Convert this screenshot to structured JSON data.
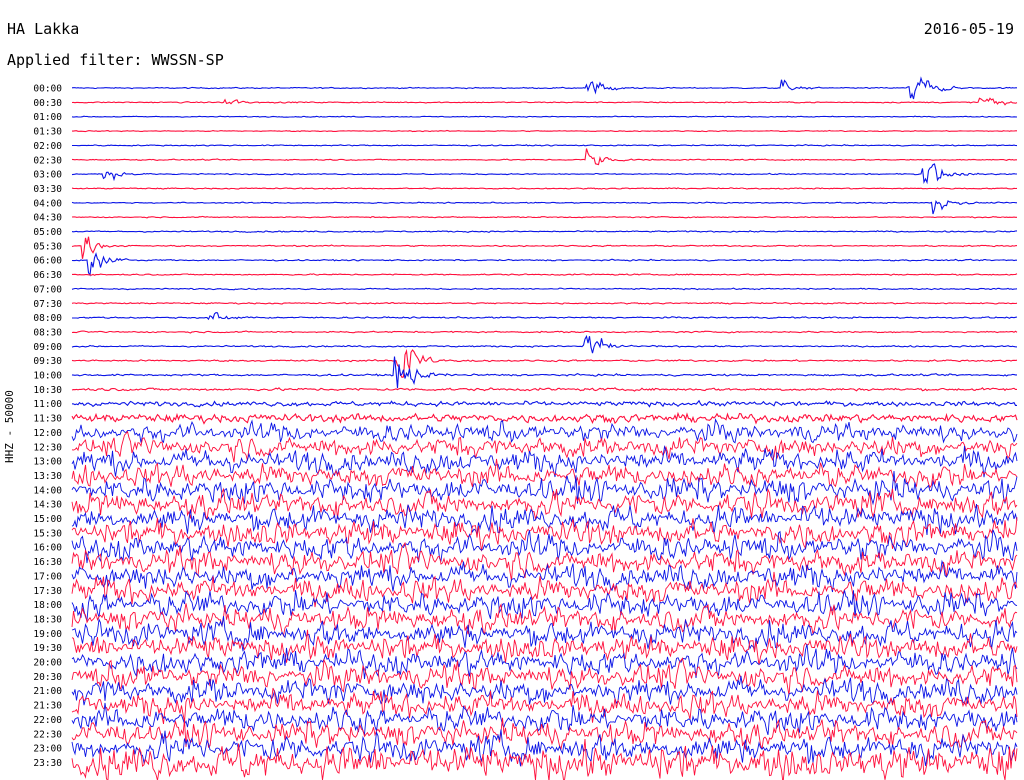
{
  "header": {
    "station": "HA Lakka",
    "date": "2016-05-19",
    "filter_text": "Applied filter: WWSSN-SP",
    "channel_text": "HHZ - 50000"
  },
  "colors": {
    "trace_a": "#0a14e6",
    "trace_b": "#ff0f3c",
    "background": "#ffffff",
    "text": "#000000"
  },
  "chart_data": {
    "type": "line",
    "title": "HA Lakka",
    "subtitle": "Applied filter: WWSSN-SP",
    "ylabel": "HHZ - 50000",
    "date": "2016-05-19",
    "row_minutes": 30,
    "row_labels": [
      "00:00",
      "00:30",
      "01:00",
      "01:30",
      "02:00",
      "02:30",
      "03:00",
      "03:30",
      "04:00",
      "04:30",
      "05:00",
      "05:30",
      "06:00",
      "06:30",
      "07:00",
      "07:30",
      "08:00",
      "08:30",
      "09:00",
      "09:30",
      "10:00",
      "10:30",
      "11:00",
      "11:30",
      "12:00",
      "12:30",
      "13:00",
      "13:30",
      "14:00",
      "14:30",
      "15:00",
      "15:30",
      "16:00",
      "16:30",
      "17:00",
      "17:30",
      "18:00",
      "18:30",
      "19:00",
      "19:30",
      "20:00",
      "20:30",
      "21:00",
      "21:30",
      "22:00",
      "22:30",
      "23:00",
      "23:30"
    ],
    "series": [
      {
        "color": "#0a14e6",
        "rows": "even"
      },
      {
        "color": "#ff0f3c",
        "rows": "odd"
      }
    ],
    "noise_level_by_row": [
      0.12,
      0.12,
      0.1,
      0.1,
      0.12,
      0.12,
      0.12,
      0.12,
      0.12,
      0.12,
      0.14,
      0.14,
      0.14,
      0.14,
      0.14,
      0.14,
      0.16,
      0.16,
      0.16,
      0.18,
      0.2,
      0.28,
      0.5,
      0.9,
      1.6,
      1.8,
      2.0,
      2.0,
      2.2,
      2.2,
      2.2,
      2.2,
      2.2,
      2.2,
      2.2,
      2.2,
      2.2,
      2.2,
      2.2,
      2.2,
      2.2,
      2.2,
      2.2,
      2.2,
      2.2,
      2.2,
      2.4,
      3.0
    ],
    "events": [
      {
        "row": 0,
        "minute": 16.3,
        "amplitude": 1.2
      },
      {
        "row": 0,
        "minute": 22.5,
        "amplitude": 0.8
      },
      {
        "row": 0,
        "minute": 26.5,
        "amplitude": 3.0
      },
      {
        "row": 1,
        "minute": 4.8,
        "amplitude": 0.6
      },
      {
        "row": 1,
        "minute": 28.8,
        "amplitude": 1.2
      },
      {
        "row": 5,
        "minute": 16.3,
        "amplitude": 1.4
      },
      {
        "row": 6,
        "minute": 1.0,
        "amplitude": 0.8
      },
      {
        "row": 6,
        "minute": 27.0,
        "amplitude": 2.2
      },
      {
        "row": 8,
        "minute": 27.3,
        "amplitude": 1.2
      },
      {
        "row": 11,
        "minute": 0.3,
        "amplitude": 1.6
      },
      {
        "row": 12,
        "minute": 0.5,
        "amplitude": 1.8
      },
      {
        "row": 16,
        "minute": 4.3,
        "amplitude": 0.9
      },
      {
        "row": 18,
        "minute": 16.2,
        "amplitude": 2.4
      },
      {
        "row": 19,
        "minute": 10.3,
        "amplitude": 4.0
      },
      {
        "row": 20,
        "minute": 10.2,
        "amplitude": 3.0
      }
    ]
  }
}
